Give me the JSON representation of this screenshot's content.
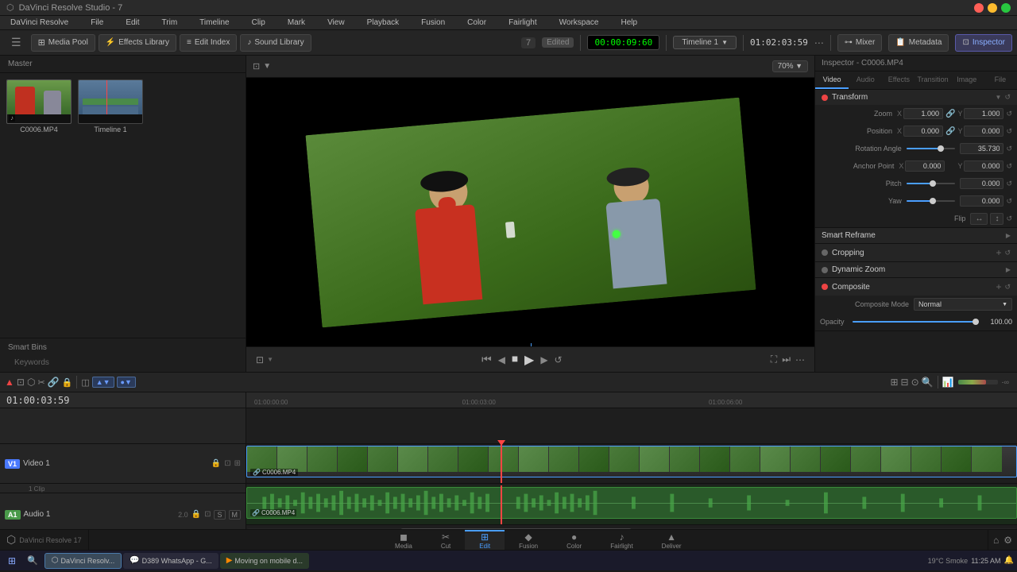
{
  "app": {
    "title": "DaVinci Resolve Studio - 7",
    "version": "DaVinci Resolve Studio 7"
  },
  "menu": {
    "items": [
      "DaVinci Resolve",
      "File",
      "Edit",
      "Trim",
      "Timeline",
      "Clip",
      "Mark",
      "View",
      "Playback",
      "Fusion",
      "Color",
      "Fairlight",
      "Workspace",
      "Help"
    ]
  },
  "toolbar": {
    "media_pool_label": "Media Pool",
    "effects_library_label": "Effects Library",
    "edit_index_label": "Edit Index",
    "sound_library_label": "Sound Library",
    "zoom_level": "70%",
    "timecode": "00:00:09:60",
    "timeline_name": "Timeline 1",
    "edited_badge": "Edited",
    "mixer_label": "Mixer",
    "metadata_label": "Metadata",
    "inspector_label": "Inspector",
    "timeline_code": "01:02:03:59"
  },
  "media_pool": {
    "title": "Master",
    "items": [
      {
        "label": "C0006.MP4",
        "type": "video",
        "has_audio": true
      },
      {
        "label": "Timeline 1",
        "type": "timeline"
      }
    ]
  },
  "smart_bins": {
    "title": "Smart Bins",
    "keywords": "Keywords"
  },
  "inspector": {
    "title": "Inspector - C0006.MP4",
    "tabs": [
      "Video",
      "Audio",
      "Effects",
      "Transition",
      "Image",
      "File"
    ],
    "sections": {
      "transform": {
        "title": "Transform",
        "zoom_label": "Zoom",
        "zoom_x": "1.000",
        "zoom_y": "1.000",
        "position_label": "Position",
        "position_x": "0.000",
        "position_y": "0.000",
        "rotation_label": "Rotation Angle",
        "rotation_value": "35.730",
        "anchor_label": "Anchor Point",
        "anchor_x": "0.000",
        "anchor_y": "0.000",
        "pitch_label": "Pitch",
        "pitch_value": "0.000",
        "yaw_label": "Yaw",
        "yaw_value": "0.000",
        "flip_label": "Flip"
      },
      "smart_reframe": {
        "title": "Smart Reframe"
      },
      "cropping": {
        "title": "Cropping"
      },
      "dynamic_zoom": {
        "title": "Dynamic Zoom"
      },
      "composite": {
        "title": "Composite",
        "mode_label": "Composite Mode",
        "mode_value": "Normal",
        "opacity_label": "Opacity",
        "opacity_value": "100.00"
      }
    }
  },
  "timeline": {
    "timecode": "01:00:03:59",
    "ruler_marks": [
      "01:00:00:00",
      "01:00:03:00",
      "01:00:06:00"
    ],
    "playhead_position": "01:00:03:59",
    "tracks": {
      "video": {
        "id": "V1",
        "name": "Video 1",
        "clip_label": "C0006.MP4",
        "clip_note": "1 Clip"
      },
      "audio": {
        "id": "A1",
        "name": "Audio 1",
        "level": "2.0",
        "clip_label": "C0006.MP4"
      }
    }
  },
  "nav_tabs": [
    {
      "id": "media",
      "label": "Media",
      "icon": "◼"
    },
    {
      "id": "cut",
      "label": "Cut",
      "icon": "✂"
    },
    {
      "id": "edit",
      "label": "Edit",
      "icon": "⊞",
      "active": true
    },
    {
      "id": "fusion",
      "label": "Fusion",
      "icon": "◆"
    },
    {
      "id": "color",
      "label": "Color",
      "icon": "●"
    },
    {
      "id": "fairlight",
      "label": "Fairlight",
      "icon": "♪"
    },
    {
      "id": "deliver",
      "label": "Deliver",
      "icon": "▲"
    }
  ],
  "windows_taskbar": {
    "items": [
      {
        "label": "DaVinci Resolv...",
        "active": true
      },
      {
        "label": "D389 WhatsApp - G..."
      },
      {
        "label": "Moving on mobile d..."
      }
    ],
    "sys_tray": {
      "temp": "19°C",
      "location": "Smoke",
      "time": "11:25",
      "date": "AM"
    }
  },
  "preview": {
    "current_time": "01:00:03:59"
  }
}
